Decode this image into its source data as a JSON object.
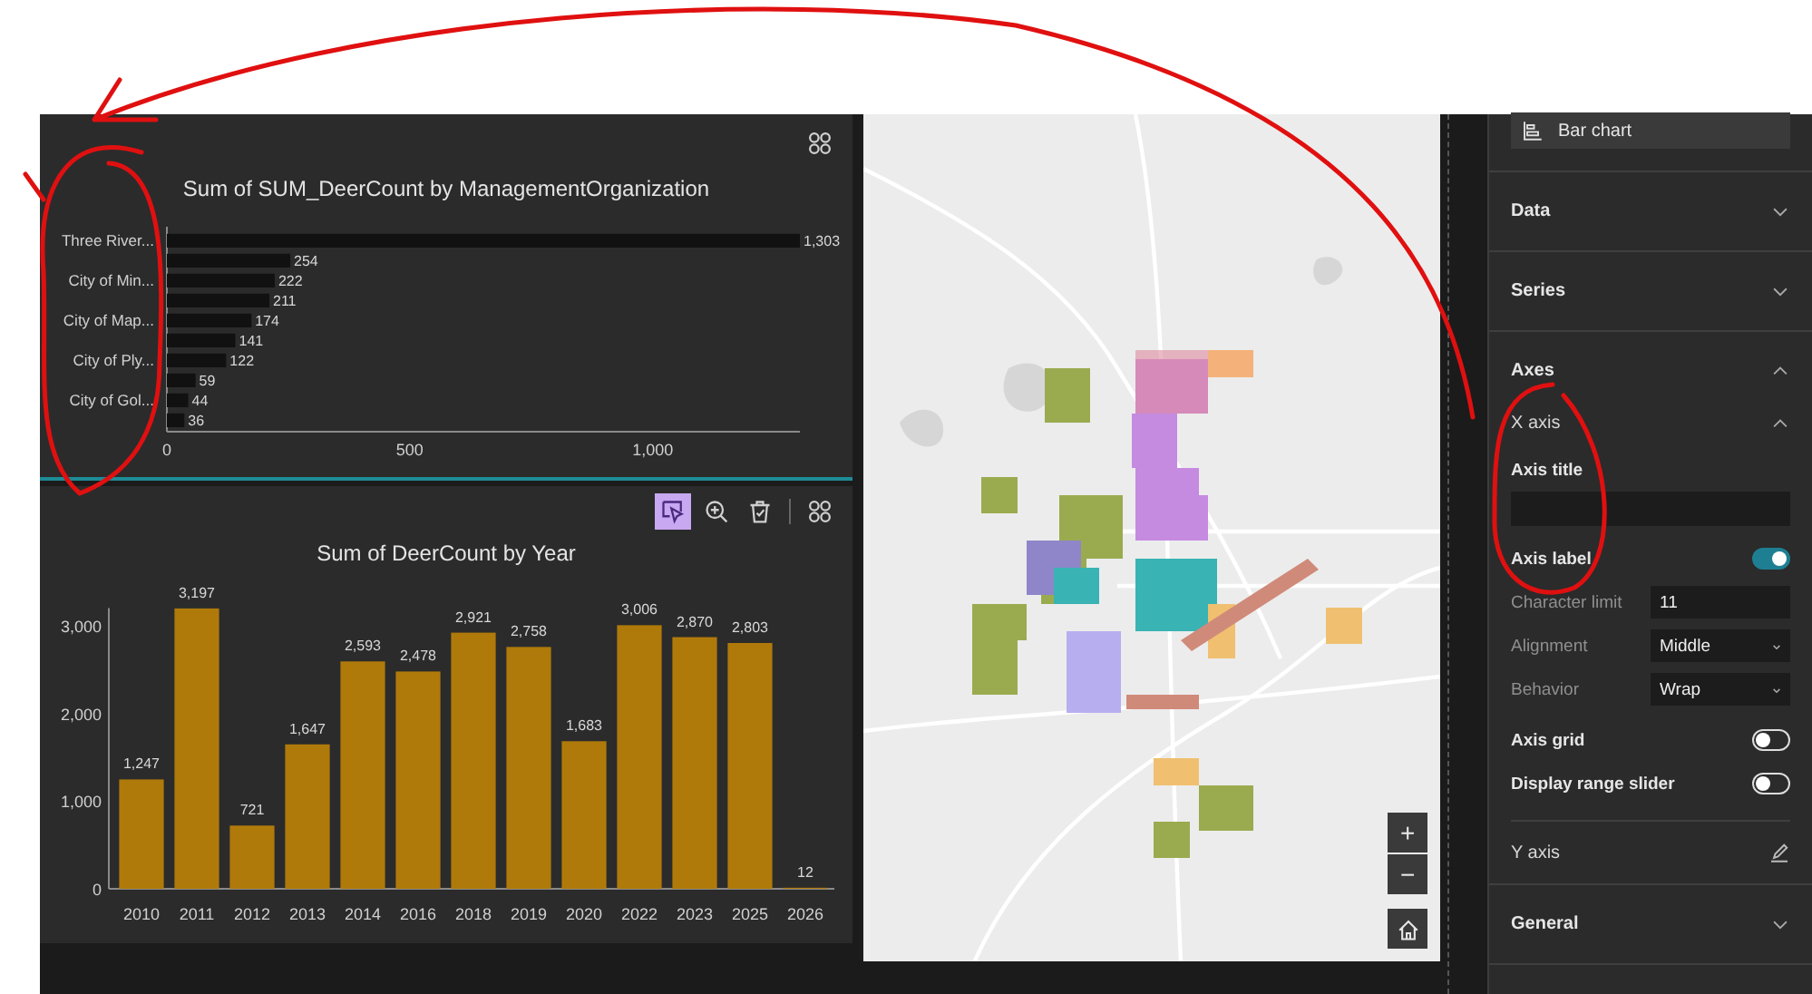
{
  "charts": [
    {
      "toolbar": [
        {
          "kind": "layout",
          "selected": false
        }
      ],
      "selected": true,
      "chart_data": {
        "type": "bar",
        "orientation": "horizontal",
        "title": "Sum of SUM_DeerCount by ManagementOrganization",
        "categories": [
          "Three River...",
          null,
          "City of Min...",
          null,
          "City of Map...",
          null,
          "City of Ply...",
          null,
          "City of Gol...",
          null
        ],
        "series": [
          {
            "color": "#111111",
            "values": [
              1303,
              254,
              222,
              211,
              174,
              141,
              122,
              59,
              44,
              36
            ]
          }
        ],
        "xlim": [
          0,
          1303
        ],
        "xticks": [
          0,
          500,
          {
            "value": 1000,
            "label": "1,000"
          }
        ],
        "value_labels": [
          "1,303",
          "254",
          "222",
          "211",
          "174",
          "141",
          "122",
          "59",
          "44",
          "36"
        ]
      }
    },
    {
      "toolbar": [
        {
          "kind": "select",
          "selected": true
        },
        {
          "kind": "zoom",
          "selected": false
        },
        {
          "kind": "clear",
          "selected": false
        },
        {
          "kind": "layout",
          "selected": false
        }
      ],
      "selected": false,
      "chart_data": {
        "type": "bar",
        "orientation": "vertical",
        "title": "Sum of DeerCount by Year",
        "categories": [
          "2010",
          "2011",
          "2012",
          "2013",
          "2014",
          "2016",
          "2018",
          "2019",
          "2020",
          "2022",
          "2023",
          "2025",
          "2026"
        ],
        "series": [
          {
            "color": "#b07a0a",
            "values": [
              1247,
              3197,
              721,
              1647,
              2593,
              2478,
              2921,
              2758,
              1683,
              3006,
              2870,
              2803,
              12
            ]
          }
        ],
        "ylim": [
          0,
          3200
        ],
        "yticks": [
          0,
          {
            "value": 1000,
            "label": "1,000"
          },
          {
            "value": 2000,
            "label": "2,000"
          },
          {
            "value": 3000,
            "label": "3,000"
          }
        ],
        "value_labels": [
          "1,247",
          "3,197",
          "721",
          "1,647",
          "2,593",
          "2,478",
          "2,921",
          "2,758",
          "1,683",
          "3,006",
          "2,870",
          "2,803",
          "12"
        ]
      }
    }
  ],
  "map": {
    "zoom_in": "+",
    "zoom_out": "−"
  },
  "properties": {
    "chart_type": "Bar chart",
    "items": [
      {
        "kind": "section",
        "label": "Data",
        "expanded": false
      },
      {
        "kind": "section",
        "label": "Series",
        "expanded": false
      },
      {
        "kind": "section",
        "label": "Axes",
        "expanded": true
      },
      {
        "kind": "subsection",
        "label": "X axis",
        "expanded": true
      },
      {
        "kind": "field",
        "label": "Axis title"
      },
      {
        "kind": "toggle",
        "label": "Axis label",
        "on": true
      },
      {
        "kind": "input",
        "label": "Character limit",
        "value": "11"
      },
      {
        "kind": "select",
        "label": "Alignment",
        "value": "Middle"
      },
      {
        "kind": "select",
        "label": "Behavior",
        "value": "Wrap"
      },
      {
        "kind": "toggle",
        "label": "Axis grid",
        "on": false
      },
      {
        "kind": "toggle",
        "label": "Display range slider",
        "on": false
      },
      {
        "kind": "edit",
        "label": "Y axis"
      },
      {
        "kind": "section",
        "label": "General",
        "expanded": false
      }
    ]
  }
}
